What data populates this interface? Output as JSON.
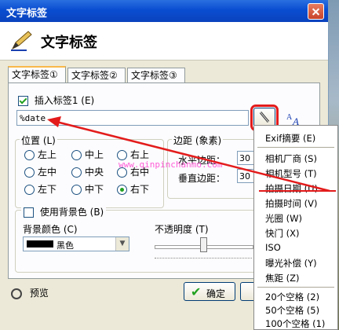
{
  "window": {
    "title": "文字标签"
  },
  "header": {
    "title": "文字标签"
  },
  "tabs": [
    {
      "label": "文字标签①"
    },
    {
      "label": "文字标签②"
    },
    {
      "label": "文字标签③"
    }
  ],
  "insert": {
    "label": "插入标签1 (E)",
    "checked": true
  },
  "textfield": {
    "value": "%date"
  },
  "position": {
    "legend": "位置 (L)",
    "options": [
      "左上",
      "中上",
      "右上",
      "左中",
      "中央",
      "右中",
      "左下",
      "中下",
      "右下"
    ],
    "selected": "右下"
  },
  "margin": {
    "legend": "边距 (象素)",
    "h_label": "水平边距：",
    "h_value": "30",
    "v_label": "垂直边距：",
    "v_value": "30"
  },
  "bg": {
    "use_label": "使用背景色 (B)",
    "checked": false,
    "color_label": "背景颜色 (C)",
    "color_value": "黑色",
    "color_swatch": "#000000",
    "opacity_label": "不透明度 (T)",
    "opacity_level": 0.5
  },
  "footer": {
    "preview": "预览",
    "ok": "确定"
  },
  "watermark": "www.qinpinchanmo.com",
  "menu": {
    "groups": [
      [
        "Exif摘要 (E)"
      ],
      [
        "相机厂商 (S)",
        "相机型号 (T)",
        "拍摄日期 (U)",
        "拍摄时间 (V)",
        "光圈 (W)",
        "快门 (X)",
        "ISO",
        "曝光补偿 (Y)",
        "焦距 (Z)"
      ],
      [
        "20个空格 (2)",
        "50个空格 (5)",
        "100个空格 (1)"
      ]
    ]
  },
  "colors": {
    "highlight": "#e31b1b",
    "accent": "#21a121"
  }
}
